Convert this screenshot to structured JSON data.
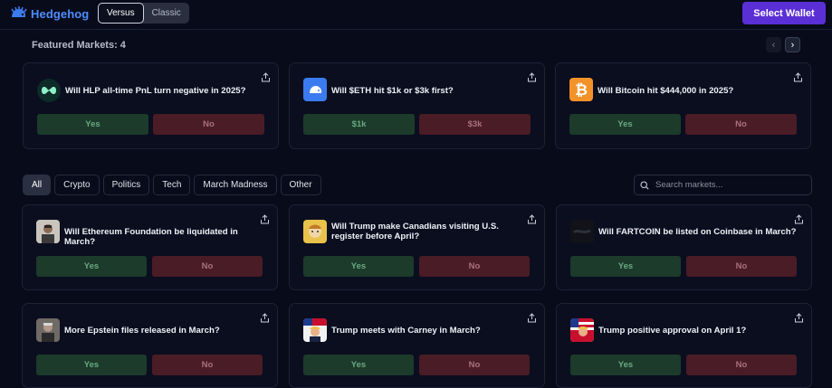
{
  "header": {
    "logo_text": "Hedgehog",
    "modes": [
      "Versus",
      "Classic"
    ],
    "active_mode": "Versus",
    "wallet_label": "Select Wallet"
  },
  "featured": {
    "title": "Featured Markets: 4",
    "prev_glyph": "‹",
    "next_glyph": "›",
    "cards": [
      {
        "question": "Will HLP all-time PnL turn negative in 2025?",
        "yes": "Yes",
        "no": "No",
        "icon": "hyperliquid-icon",
        "color": "#0d2b28"
      },
      {
        "question": "Will $ETH hit $1k or $3k first?",
        "yes": "$1k",
        "no": "$3k",
        "icon": "hedgehog-icon",
        "color": "#3b7bf0"
      },
      {
        "question": "Will Bitcoin hit $444,000 in 2025?",
        "yes": "Yes",
        "no": "No",
        "icon": "bitcoin-icon",
        "color": "#f4922a"
      }
    ]
  },
  "filters": {
    "chips": [
      "All",
      "Crypto",
      "Politics",
      "Tech",
      "March Madness",
      "Other"
    ],
    "active": "All"
  },
  "search": {
    "placeholder": "Search markets..."
  },
  "markets": [
    {
      "question": "Will Ethereum Foundation be liquidated in March?",
      "yes": "Yes",
      "no": "No",
      "icon": "person-photo-icon"
    },
    {
      "question": "Will Trump make Canadians visiting U.S. register before April?",
      "yes": "Yes",
      "no": "No",
      "icon": "cartoon-icon"
    },
    {
      "question": "Will FARTCOIN be listed on Coinbase in March?",
      "yes": "Yes",
      "no": "No",
      "icon": "fartcoin-icon"
    },
    {
      "question": "More Epstein files released in March?",
      "yes": "Yes",
      "no": "No",
      "icon": "person-photo-icon"
    },
    {
      "question": "Trump meets with Carney in March?",
      "yes": "Yes",
      "no": "No",
      "icon": "trump-flag-icon"
    },
    {
      "question": "Trump positive approval on April 1?",
      "yes": "Yes",
      "no": "No",
      "icon": "trump-flag-icon"
    }
  ]
}
